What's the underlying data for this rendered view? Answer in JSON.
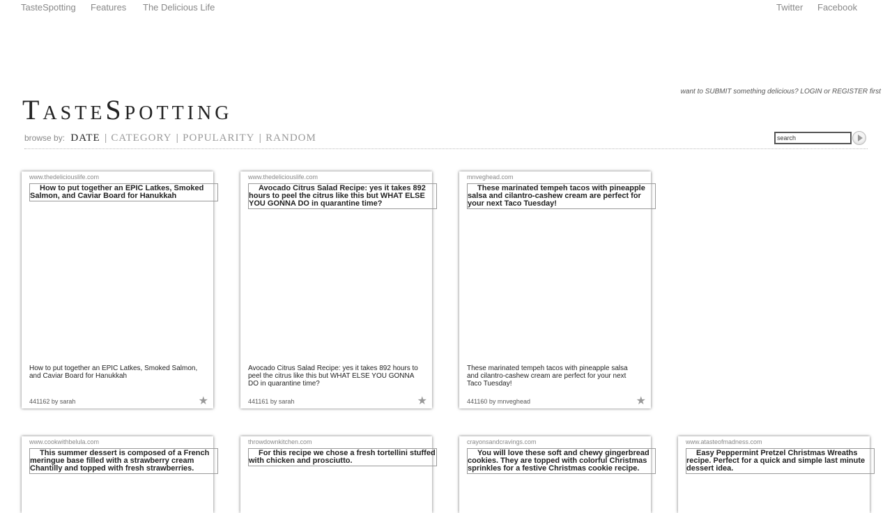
{
  "topnav": {
    "left": [
      "TasteSpotting",
      "Features",
      "The Delicious Life"
    ],
    "right": [
      "Twitter",
      "Facebook"
    ]
  },
  "header": {
    "logo": "TasteSpotting",
    "submit_line": "want to SUBMIT something delicious? LOGIN or REGISTER first",
    "browse_label": "browse by:",
    "browse_options": [
      "DATE",
      "CATEGORY",
      "POPULARITY",
      "RANDOM"
    ],
    "active_option": "DATE",
    "search_value": "search"
  },
  "icons": {
    "go": "arrow-right-icon",
    "fave": "star-icon"
  },
  "colors": {
    "text": "#333333",
    "muted": "#888888",
    "star": "#999999"
  },
  "cards": [
    {
      "domain": "www.thedeliciouslife.com",
      "alt": "How to put together an EPIC Latkes, Smoked Salmon, and Caviar Board for Hanukkah",
      "caption": "How to put together an EPIC Latkes, Smoked Salmon, and Caviar Board for Hanukkah",
      "id": "441162",
      "by": "by",
      "user": "sarah"
    },
    {
      "domain": "www.thedeliciouslife.com",
      "alt": "Avocado Citrus Salad Recipe: yes it takes 892 hours to peel the citrus like this but WHAT ELSE YOU GONNA DO in quarantine time?",
      "caption": "Avocado Citrus Salad Recipe: yes it takes 892 hours to peel the citrus like this but WHAT ELSE YOU GONNA DO in quarantine time?",
      "id": "441161",
      "by": "by",
      "user": "sarah"
    },
    {
      "domain": "mnveghead.com",
      "alt": "These marinated tempeh tacos with pineapple salsa and cilantro-cashew cream are perfect for your next Taco Tuesday!",
      "caption": "These marinated tempeh tacos with pineapple salsa and cilantro-cashew cream are perfect for your next Taco Tuesday!",
      "id": "441160",
      "by": "by",
      "user": "mnveghead"
    },
    {
      "domain": "www.cookwithbelula.com",
      "alt": "This summer dessert is composed of a French meringue base filled with a strawberry cream Chantilly and topped with fresh strawberries."
    },
    {
      "domain": "throwdownkitchen.com",
      "alt": "For this recipe we chose a fresh tortellini stuffed with chicken and prosciutto."
    },
    {
      "domain": "crayonsandcravings.com",
      "alt": "You will love these soft and chewy gingerbread cookies. They are topped with colorful Christmas sprinkles for a festive Christmas cookie recipe."
    },
    {
      "domain": "www.atasteofmadness.com",
      "alt": "Easy Peppermint Pretzel Christmas Wreaths recipe. Perfect for a quick and simple last minute dessert idea."
    }
  ]
}
